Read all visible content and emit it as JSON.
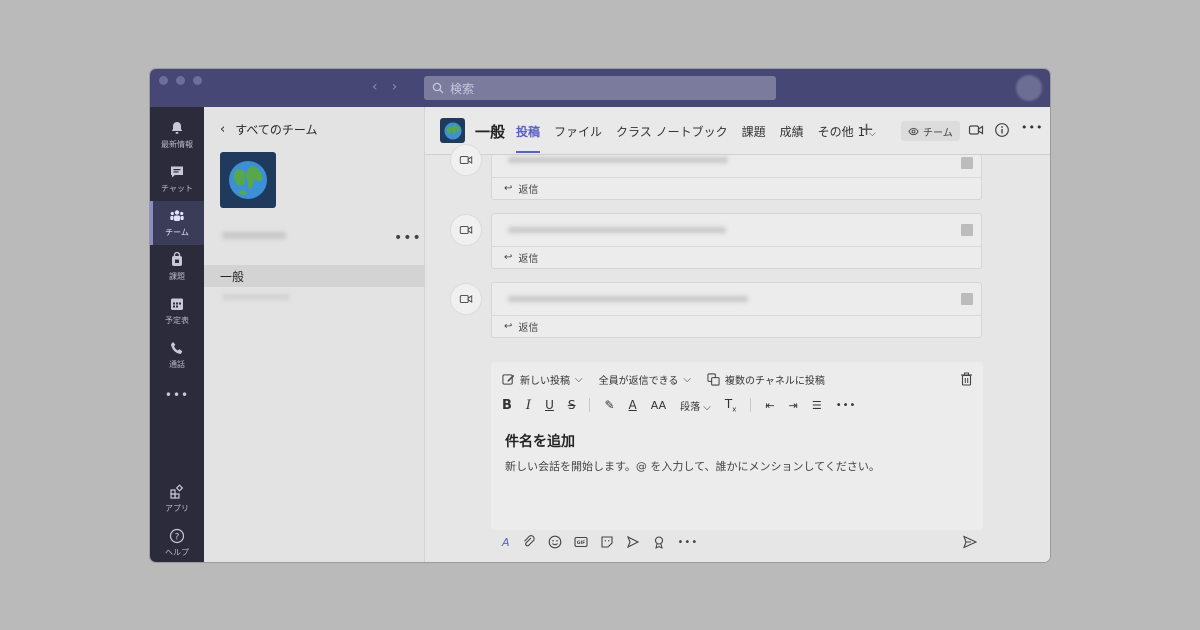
{
  "titlebar": {
    "back_arrow": "‹",
    "forward_arrow": "›",
    "search_placeholder": "検索"
  },
  "rail": {
    "items": [
      {
        "label": "最新情報",
        "icon": "bell-icon"
      },
      {
        "label": "チャット",
        "icon": "chat-icon"
      },
      {
        "label": "チーム",
        "icon": "teams-icon"
      },
      {
        "label": "課題",
        "icon": "assignments-icon"
      },
      {
        "label": "予定表",
        "icon": "calendar-icon"
      },
      {
        "label": "通話",
        "icon": "phone-icon"
      },
      {
        "label": "アプリ",
        "icon": "apps-icon"
      },
      {
        "label": "ヘルプ",
        "icon": "help-icon"
      }
    ],
    "more": "•••"
  },
  "teampanel": {
    "back_label": "すべてのチーム",
    "more": "•••",
    "channel": "一般"
  },
  "header": {
    "channel_name": "一般",
    "tabs": [
      {
        "label": "投稿"
      },
      {
        "label": "ファイル"
      },
      {
        "label": "クラス ノートブック"
      },
      {
        "label": "課題"
      },
      {
        "label": "成績"
      },
      {
        "label": "その他 1"
      }
    ],
    "plus": "+",
    "team_pill": "チーム",
    "more": "•••"
  },
  "messages": {
    "reply_label": "返信"
  },
  "compose": {
    "new_post": "新しい投稿",
    "reply_setting": "全員が返信できる",
    "multi_channel": "複数のチャネルに投稿",
    "paragraph": "段落",
    "subject": "件名を追加",
    "placeholder": "新しい会話を開始します。@ を入力して、誰かにメンションしてください。",
    "more": "•••"
  },
  "colors": {
    "titlebar": "#464775",
    "rail": "#2b2b3c",
    "accent": "#5b5fc7"
  }
}
